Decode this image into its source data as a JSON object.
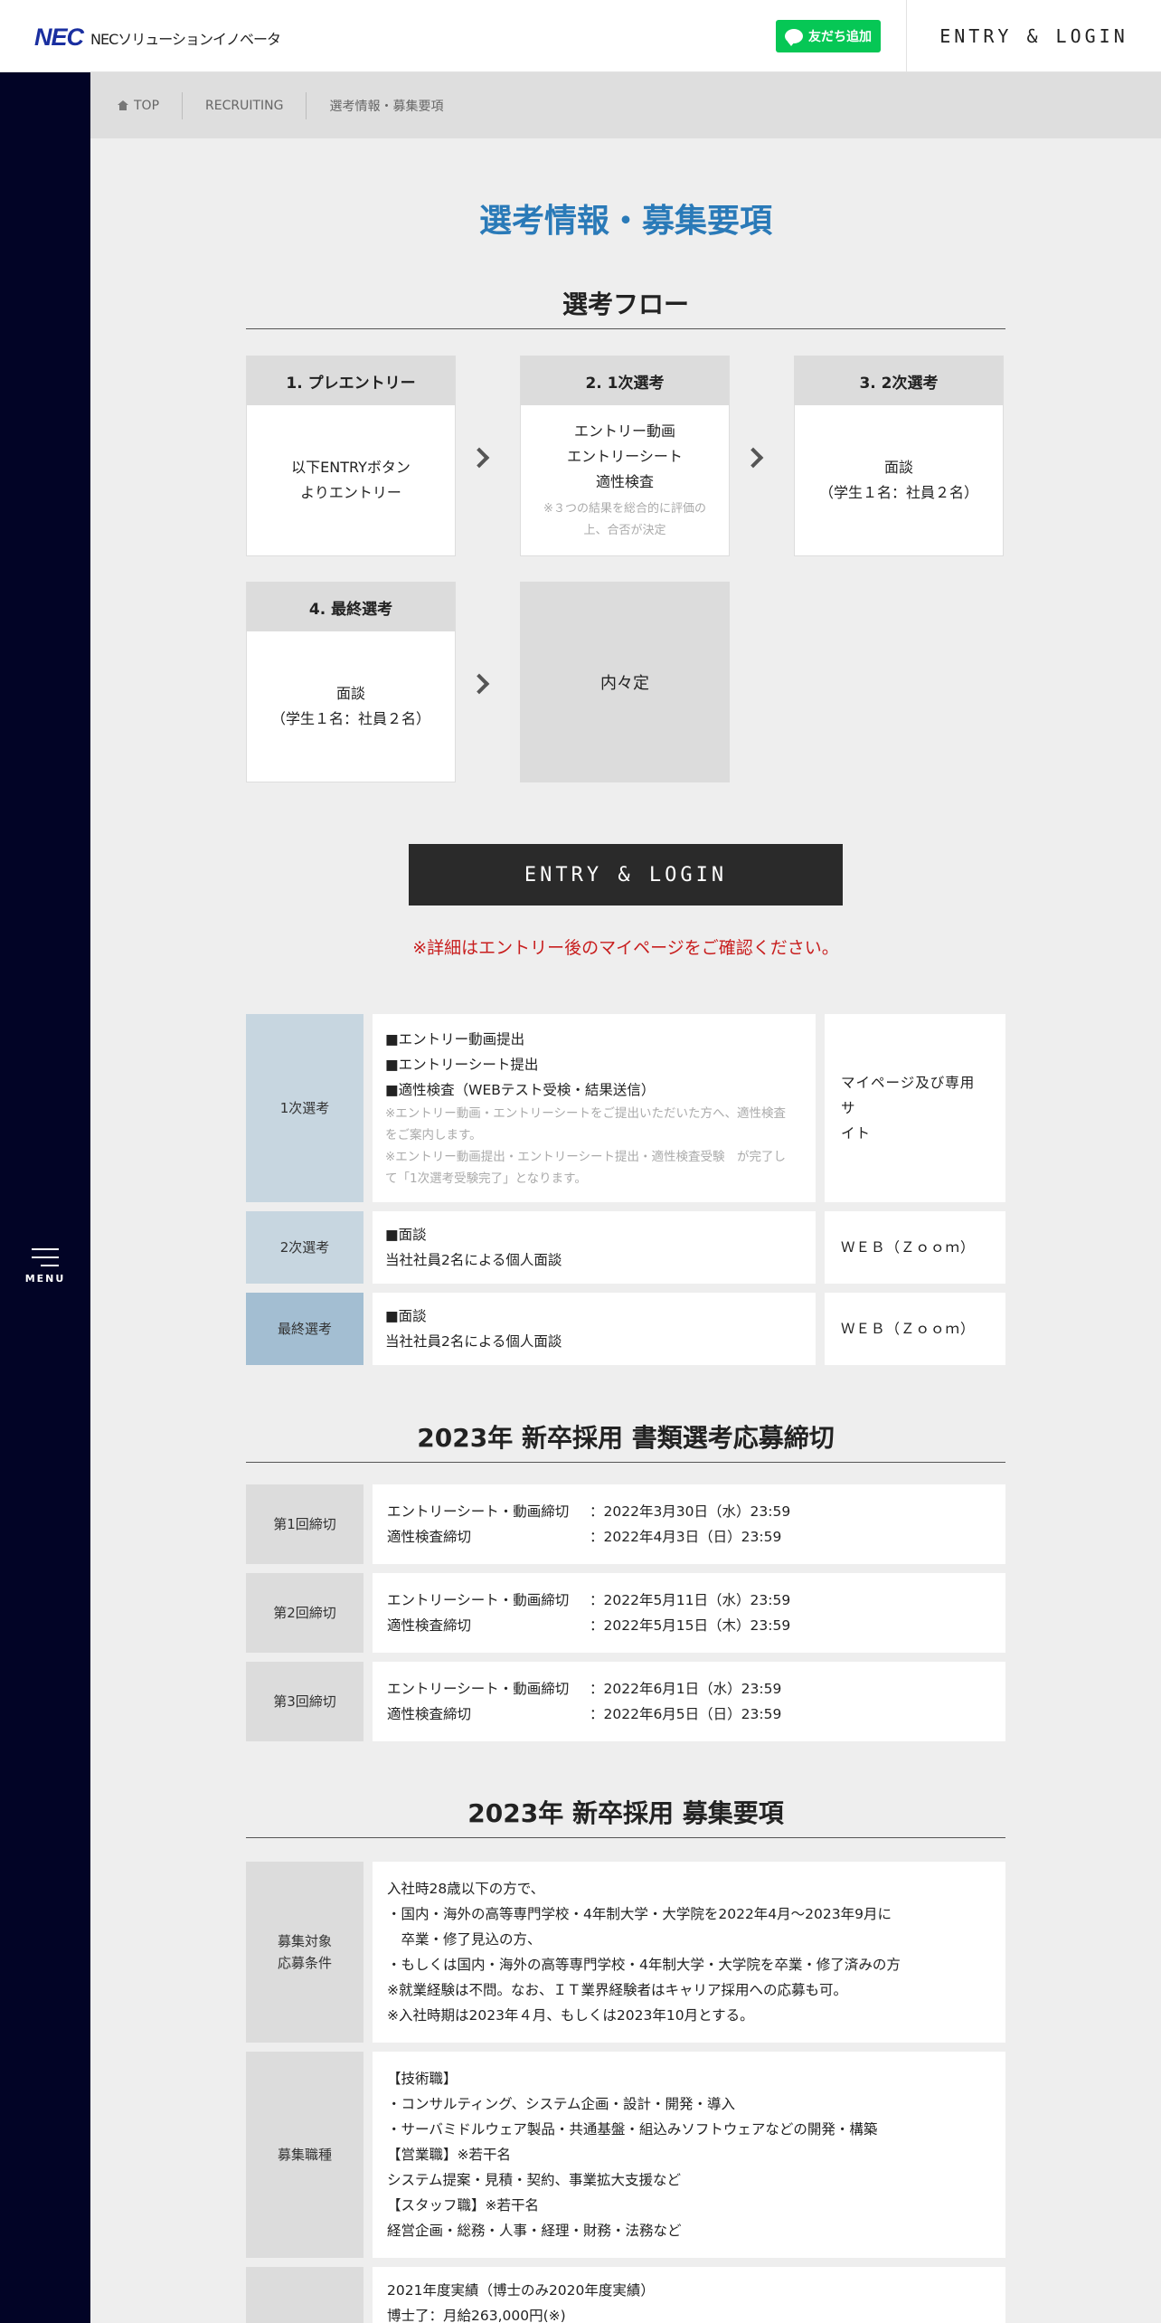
{
  "header": {
    "logo_main": "NEC",
    "logo_sub": "NECソリューションイノベータ",
    "line_button": "友だち追加",
    "entry_login": "ENTRY & LOGIN"
  },
  "sidebar": {
    "menu_label": "MENU"
  },
  "breadcrumb": [
    "TOP",
    "RECRUITING",
    "選考情報・募集要項"
  ],
  "page_title": "選考情報・募集要項",
  "flow": {
    "title": "選考フロー",
    "steps": [
      {
        "head": "1. プレエントリー",
        "lines": [
          "以下ENTRYボタン",
          "よりエントリー"
        ],
        "note": []
      },
      {
        "head": "2. 1次選考",
        "lines": [
          "エントリー動画",
          "エントリーシート",
          "適性検査"
        ],
        "note": [
          "※３つの結果を総合的に評価の",
          "上、合否が決定"
        ]
      },
      {
        "head": "3. 2次選考",
        "lines": [
          "面談",
          "（学生１名：社員２名）"
        ],
        "note": []
      },
      {
        "head": "4. 最終選考",
        "lines": [
          "面談",
          "（学生１名：社員２名）"
        ],
        "note": []
      }
    ],
    "final": "内々定"
  },
  "entry_button": "ENTRY & LOGIN",
  "notice": "※詳細はエントリー後のマイページをご確認ください。",
  "stages": [
    {
      "label": "1次選考",
      "color": "#c7d6e0",
      "lines": [
        "■エントリー動画提出",
        "■エントリーシート提出",
        "■適性検査（WEBテスト受検・結果送信）"
      ],
      "notes": [
        "※エントリー動画・エントリーシートをご提出いただいた方へ、適性検査",
        "をご案内します。",
        "※エントリー動画提出・エントリーシート提出・適性検査受験　が完了し",
        "て「1次選考受験完了」となります。"
      ],
      "side": [
        "マイページ及び専用サ",
        "イト"
      ]
    },
    {
      "label": "2次選考",
      "color": "#c7d6e0",
      "lines": [
        "■面談",
        "当社社員2名による個人面談"
      ],
      "notes": [],
      "side": [
        "ＷＥＢ（Ｚｏｏｍ）"
      ]
    },
    {
      "label": "最終選考",
      "color": "#a3bed2",
      "lines": [
        "■面談",
        "当社社員2名による個人面談"
      ],
      "notes": [],
      "side": [
        "ＷＥＢ（Ｚｏｏｍ）"
      ]
    }
  ],
  "deadlines": {
    "title": "2023年 新卒採用 書類選考応募締切",
    "rows": [
      {
        "label": "第1回締切",
        "items": [
          [
            "エントリーシート・動画締切",
            "：2022年3月30日（水）23:59"
          ],
          [
            "適性検査締切",
            "：2022年4月3日（日）23:59"
          ]
        ]
      },
      {
        "label": "第2回締切",
        "items": [
          [
            "エントリーシート・動画締切",
            "：2022年5月11日（水）23:59"
          ],
          [
            "適性検査締切",
            "：2022年5月15日（木）23:59"
          ]
        ]
      },
      {
        "label": "第3回締切",
        "items": [
          [
            "エントリーシート・動画締切",
            "：2022年6月1日（水）23:59"
          ],
          [
            "適性検査締切",
            "：2022年6月5日（日）23:59"
          ]
        ]
      }
    ]
  },
  "requirements": {
    "title": "2023年 新卒採用 募集要項",
    "rows": [
      {
        "label": [
          "募集対象",
          "応募条件"
        ],
        "lines": [
          "入社時28歳以下の方で、",
          "・国内・海外の高等専門学校・4年制大学・大学院を2022年4月～2023年9月に",
          "　卒業・修了見込の方、",
          "・もしくは国内・海外の高等専門学校・4年制大学・大学院を卒業・修了済みの方",
          "※就業経験は不問。なお、ＩＴ業界経験者はキャリア採用への応募も可。",
          "※入社時期は2023年４月、もしくは2023年10月とする。"
        ]
      },
      {
        "label": [
          "募集職種"
        ],
        "lines": [
          "【技術職】",
          "・コンサルティング、システム企画・設計・開発・導入",
          "・サーバミドルウェア製品・共通基盤・組込みソフトウェアなどの開発・構築",
          "【営業職】※若干名",
          "システム提案・見積・契約、事業拡大支援など",
          "【スタッフ職】※若干名",
          "経営企画・総務・人事・経理・財務・法務など"
        ]
      },
      {
        "label": [
          ""
        ],
        "lines": [
          "2021年度実績（博士のみ2020年度実績）",
          "博士了：月給263,000円(※)"
        ]
      }
    ]
  }
}
